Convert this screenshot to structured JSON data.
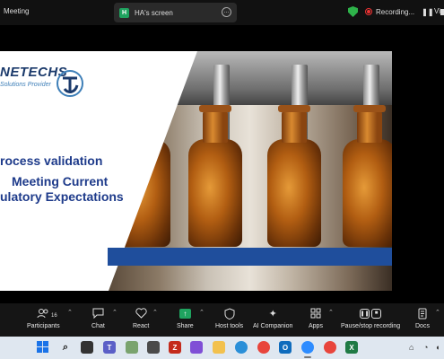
{
  "topbar": {
    "meeting_label": "Meeting",
    "screen_tab_icon": "H",
    "screen_tab_label": "HA's screen",
    "more_icon": "…",
    "recording_label": "Recording...",
    "view_label": "Vie"
  },
  "slide": {
    "logo_text": "NETECHS",
    "logo_tagline": "Solutions Provider",
    "title_line1": "rocess validation",
    "title_line2": "Meeting Current",
    "title_line3": "ulatory Expectations"
  },
  "toolbar": {
    "participants_label": "Participants",
    "participants_count": "16",
    "chat_label": "Chat",
    "react_label": "React",
    "share_label": "Share",
    "host_tools_label": "Host tools",
    "ai_companion_label": "AI Companion",
    "apps_label": "Apps",
    "pause_stop_label": "Pause/stop recording",
    "docs_label": "Docs"
  },
  "colors": {
    "accent_green": "#1fa35f",
    "record_red": "#e33333",
    "slide_blue": "#1d3a8a"
  },
  "icons": [
    "shield-icon",
    "record-icon",
    "pause-icon",
    "stop-icon",
    "participants-icon",
    "chat-icon",
    "react-icon",
    "share-icon",
    "host-tools-icon",
    "ai-companion-icon",
    "apps-icon",
    "pause-stop-icon",
    "docs-icon"
  ]
}
